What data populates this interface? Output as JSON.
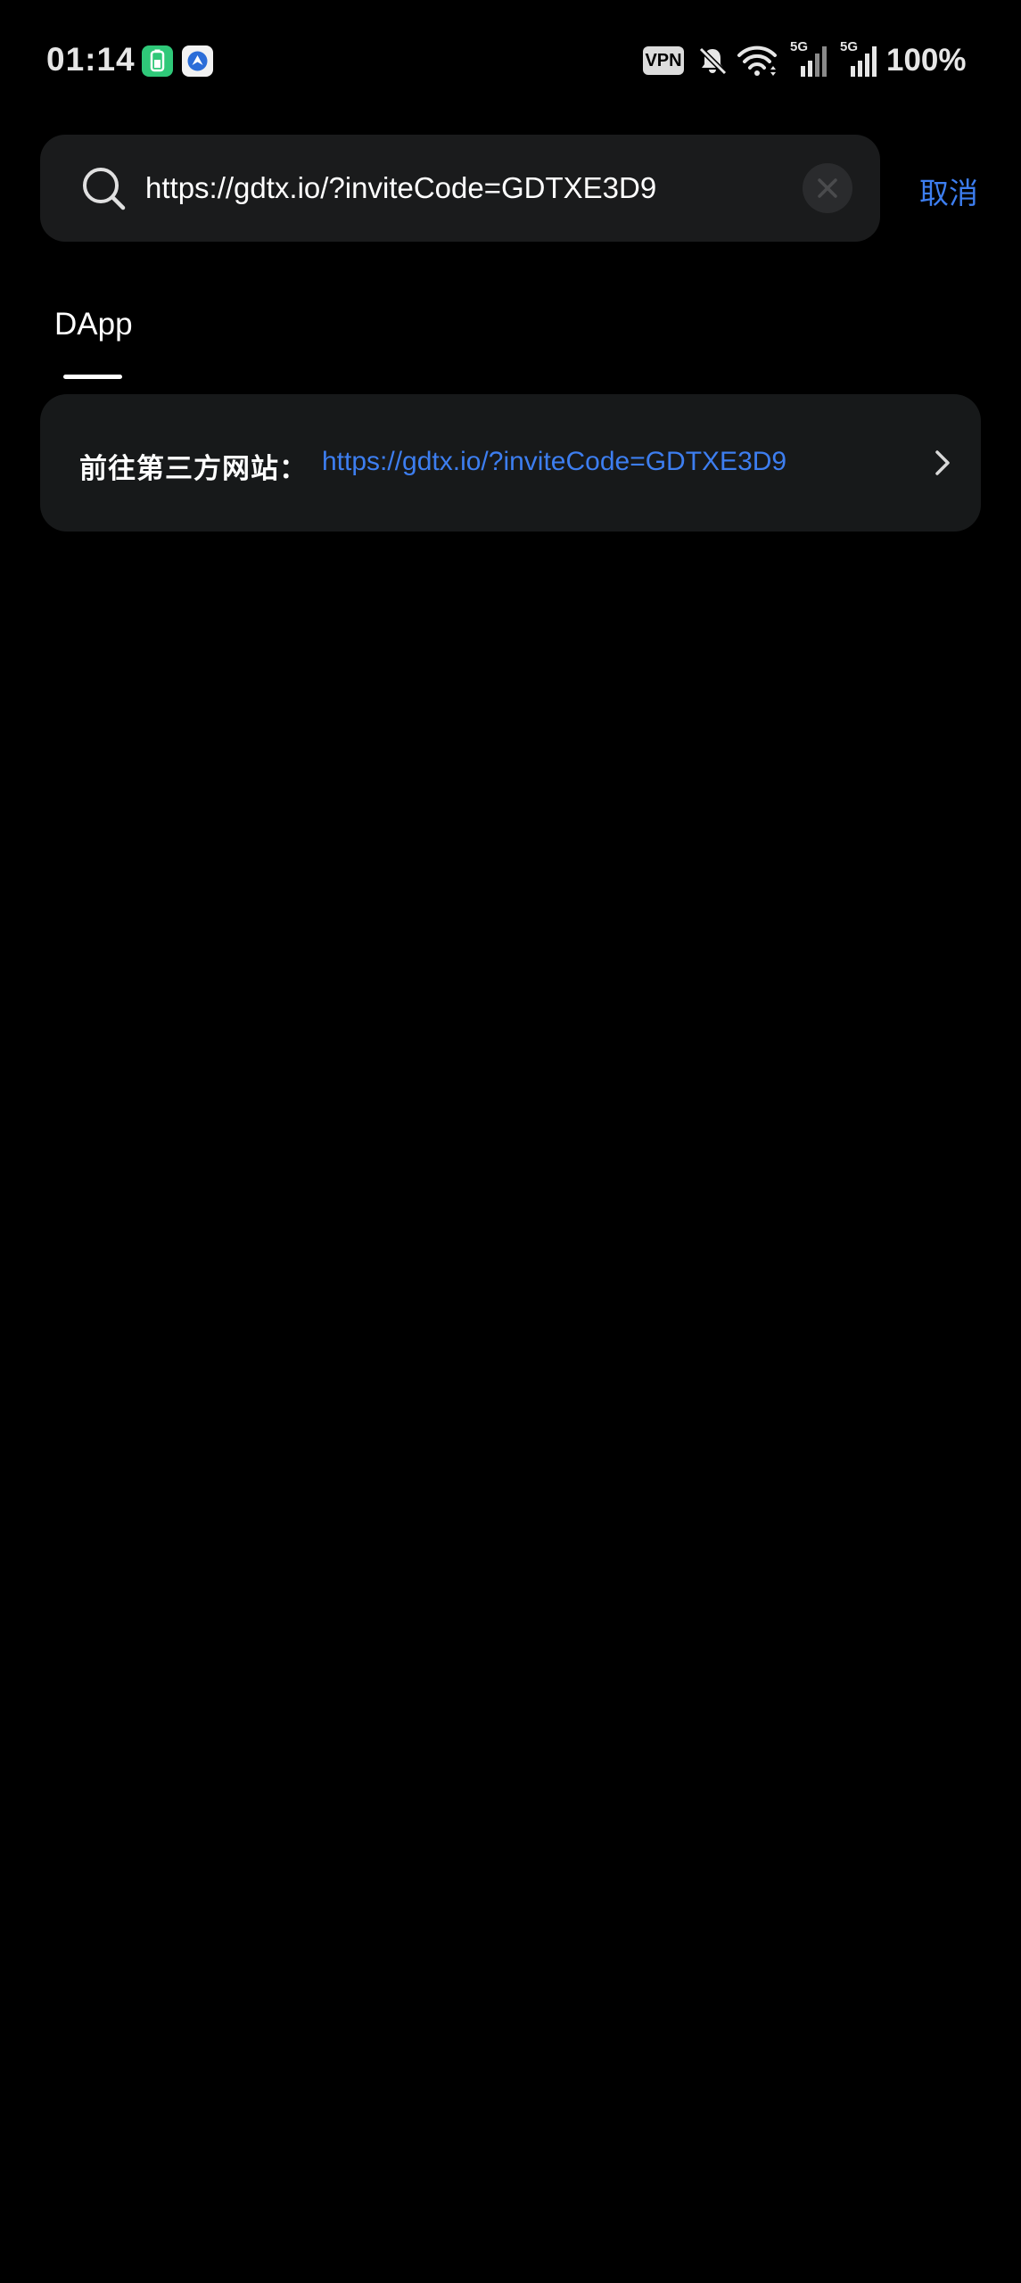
{
  "status_bar": {
    "time": "01:14",
    "vpn_label": "VPN",
    "signal_1_label": "5G",
    "signal_2_label": "5G",
    "battery": "100%",
    "icons": [
      "battery-saver-app-icon",
      "navigation-app-icon",
      "vpn-icon",
      "bell-muted-icon",
      "wifi-icon",
      "cellular-signal-icon",
      "cellular-signal-icon"
    ]
  },
  "search": {
    "value": "https://gdtx.io/?inviteCode=GDTXE3D9",
    "placeholder": "",
    "cancel_label": "取消",
    "icons": [
      "search-icon",
      "clear-icon"
    ]
  },
  "tabs": [
    {
      "label": "DApp",
      "active": true
    }
  ],
  "result": {
    "label": "前往第三方网站：",
    "link": "https://gdtx.io/?inviteCode=GDTXE3D9",
    "icon": "chevron-right-icon"
  },
  "colors": {
    "background": "#000000",
    "card": "#17191a",
    "search_box": "#1a1b1c",
    "accent": "#3d7ef0",
    "text": "#ffffff"
  }
}
